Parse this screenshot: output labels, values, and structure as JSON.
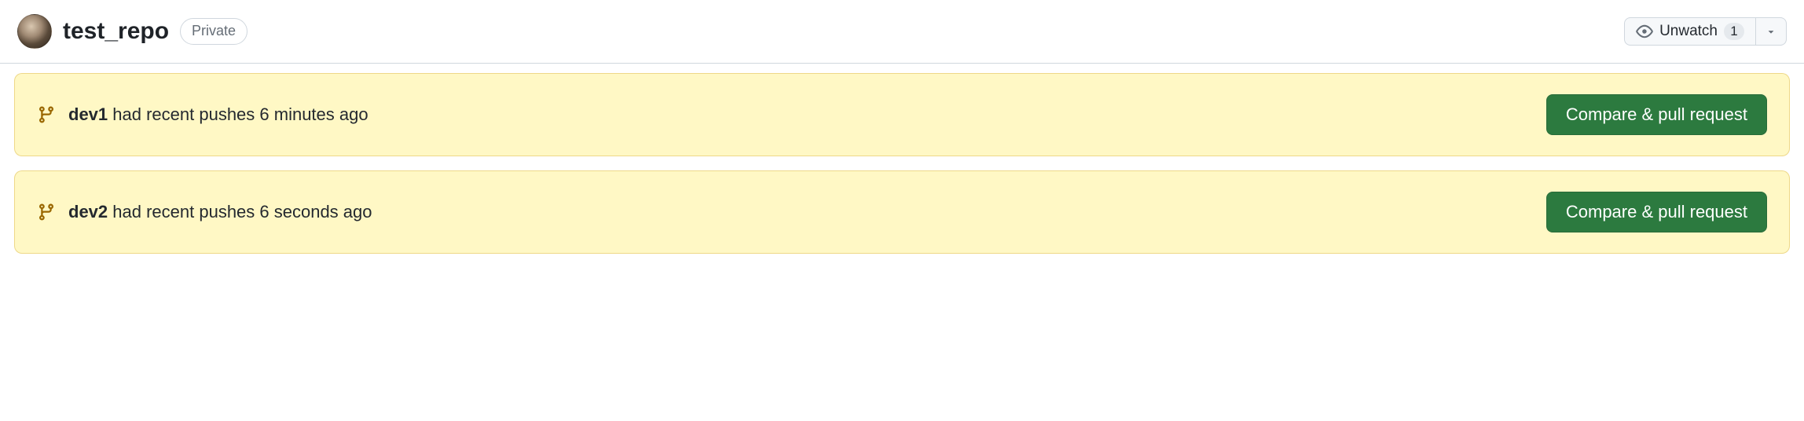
{
  "header": {
    "repo_name": "test_repo",
    "visibility": "Private",
    "watch_label": "Unwatch",
    "watch_count": "1"
  },
  "alerts": [
    {
      "branch": "dev1",
      "text_after": " had recent pushes 6 minutes ago",
      "button": "Compare & pull request"
    },
    {
      "branch": "dev2",
      "text_after": " had recent pushes 6 seconds ago",
      "button": "Compare & pull request"
    }
  ],
  "colors": {
    "alert_bg": "#fff8c5",
    "primary_btn": "#2c7a3f"
  }
}
